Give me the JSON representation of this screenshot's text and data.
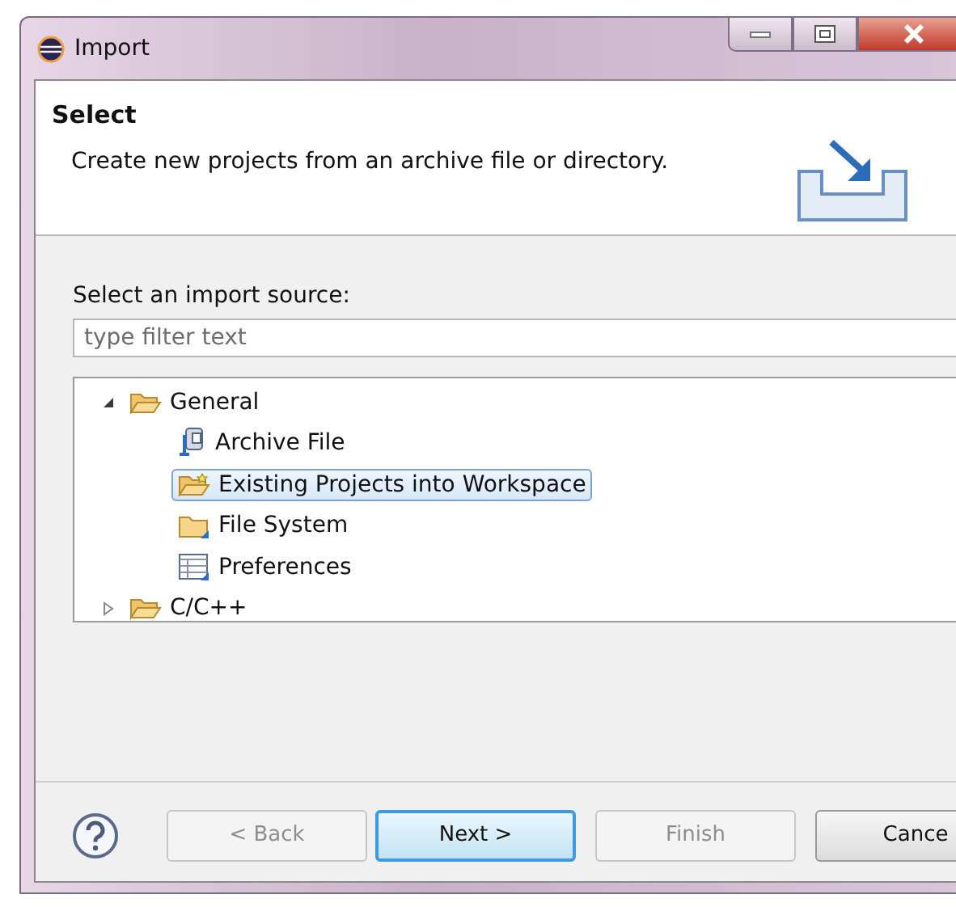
{
  "window": {
    "title": "Import"
  },
  "header": {
    "title": "Select",
    "description": "Create new projects from an archive file or directory."
  },
  "source_label": "Select an import source:",
  "filter": {
    "placeholder": "type filter text"
  },
  "tree": [
    {
      "label": "General",
      "kind": "folder",
      "expanded": true,
      "selected": false,
      "children": [
        {
          "label": "Archive File",
          "kind": "archive",
          "selected": false
        },
        {
          "label": "Existing Projects into Workspace",
          "kind": "project",
          "selected": true
        },
        {
          "label": "File System",
          "kind": "folder-plain",
          "selected": false
        },
        {
          "label": "Preferences",
          "kind": "preferences",
          "selected": false
        }
      ]
    },
    {
      "label": "C/C++",
      "kind": "folder",
      "expanded": false,
      "selected": false
    }
  ],
  "buttons": [
    {
      "label": "< Back",
      "disabled": true,
      "default": false
    },
    {
      "label": "Next >",
      "disabled": false,
      "default": true
    },
    {
      "label": "Finish",
      "disabled": true,
      "default": false
    },
    {
      "label": "Cance",
      "disabled": false,
      "default": false
    }
  ]
}
